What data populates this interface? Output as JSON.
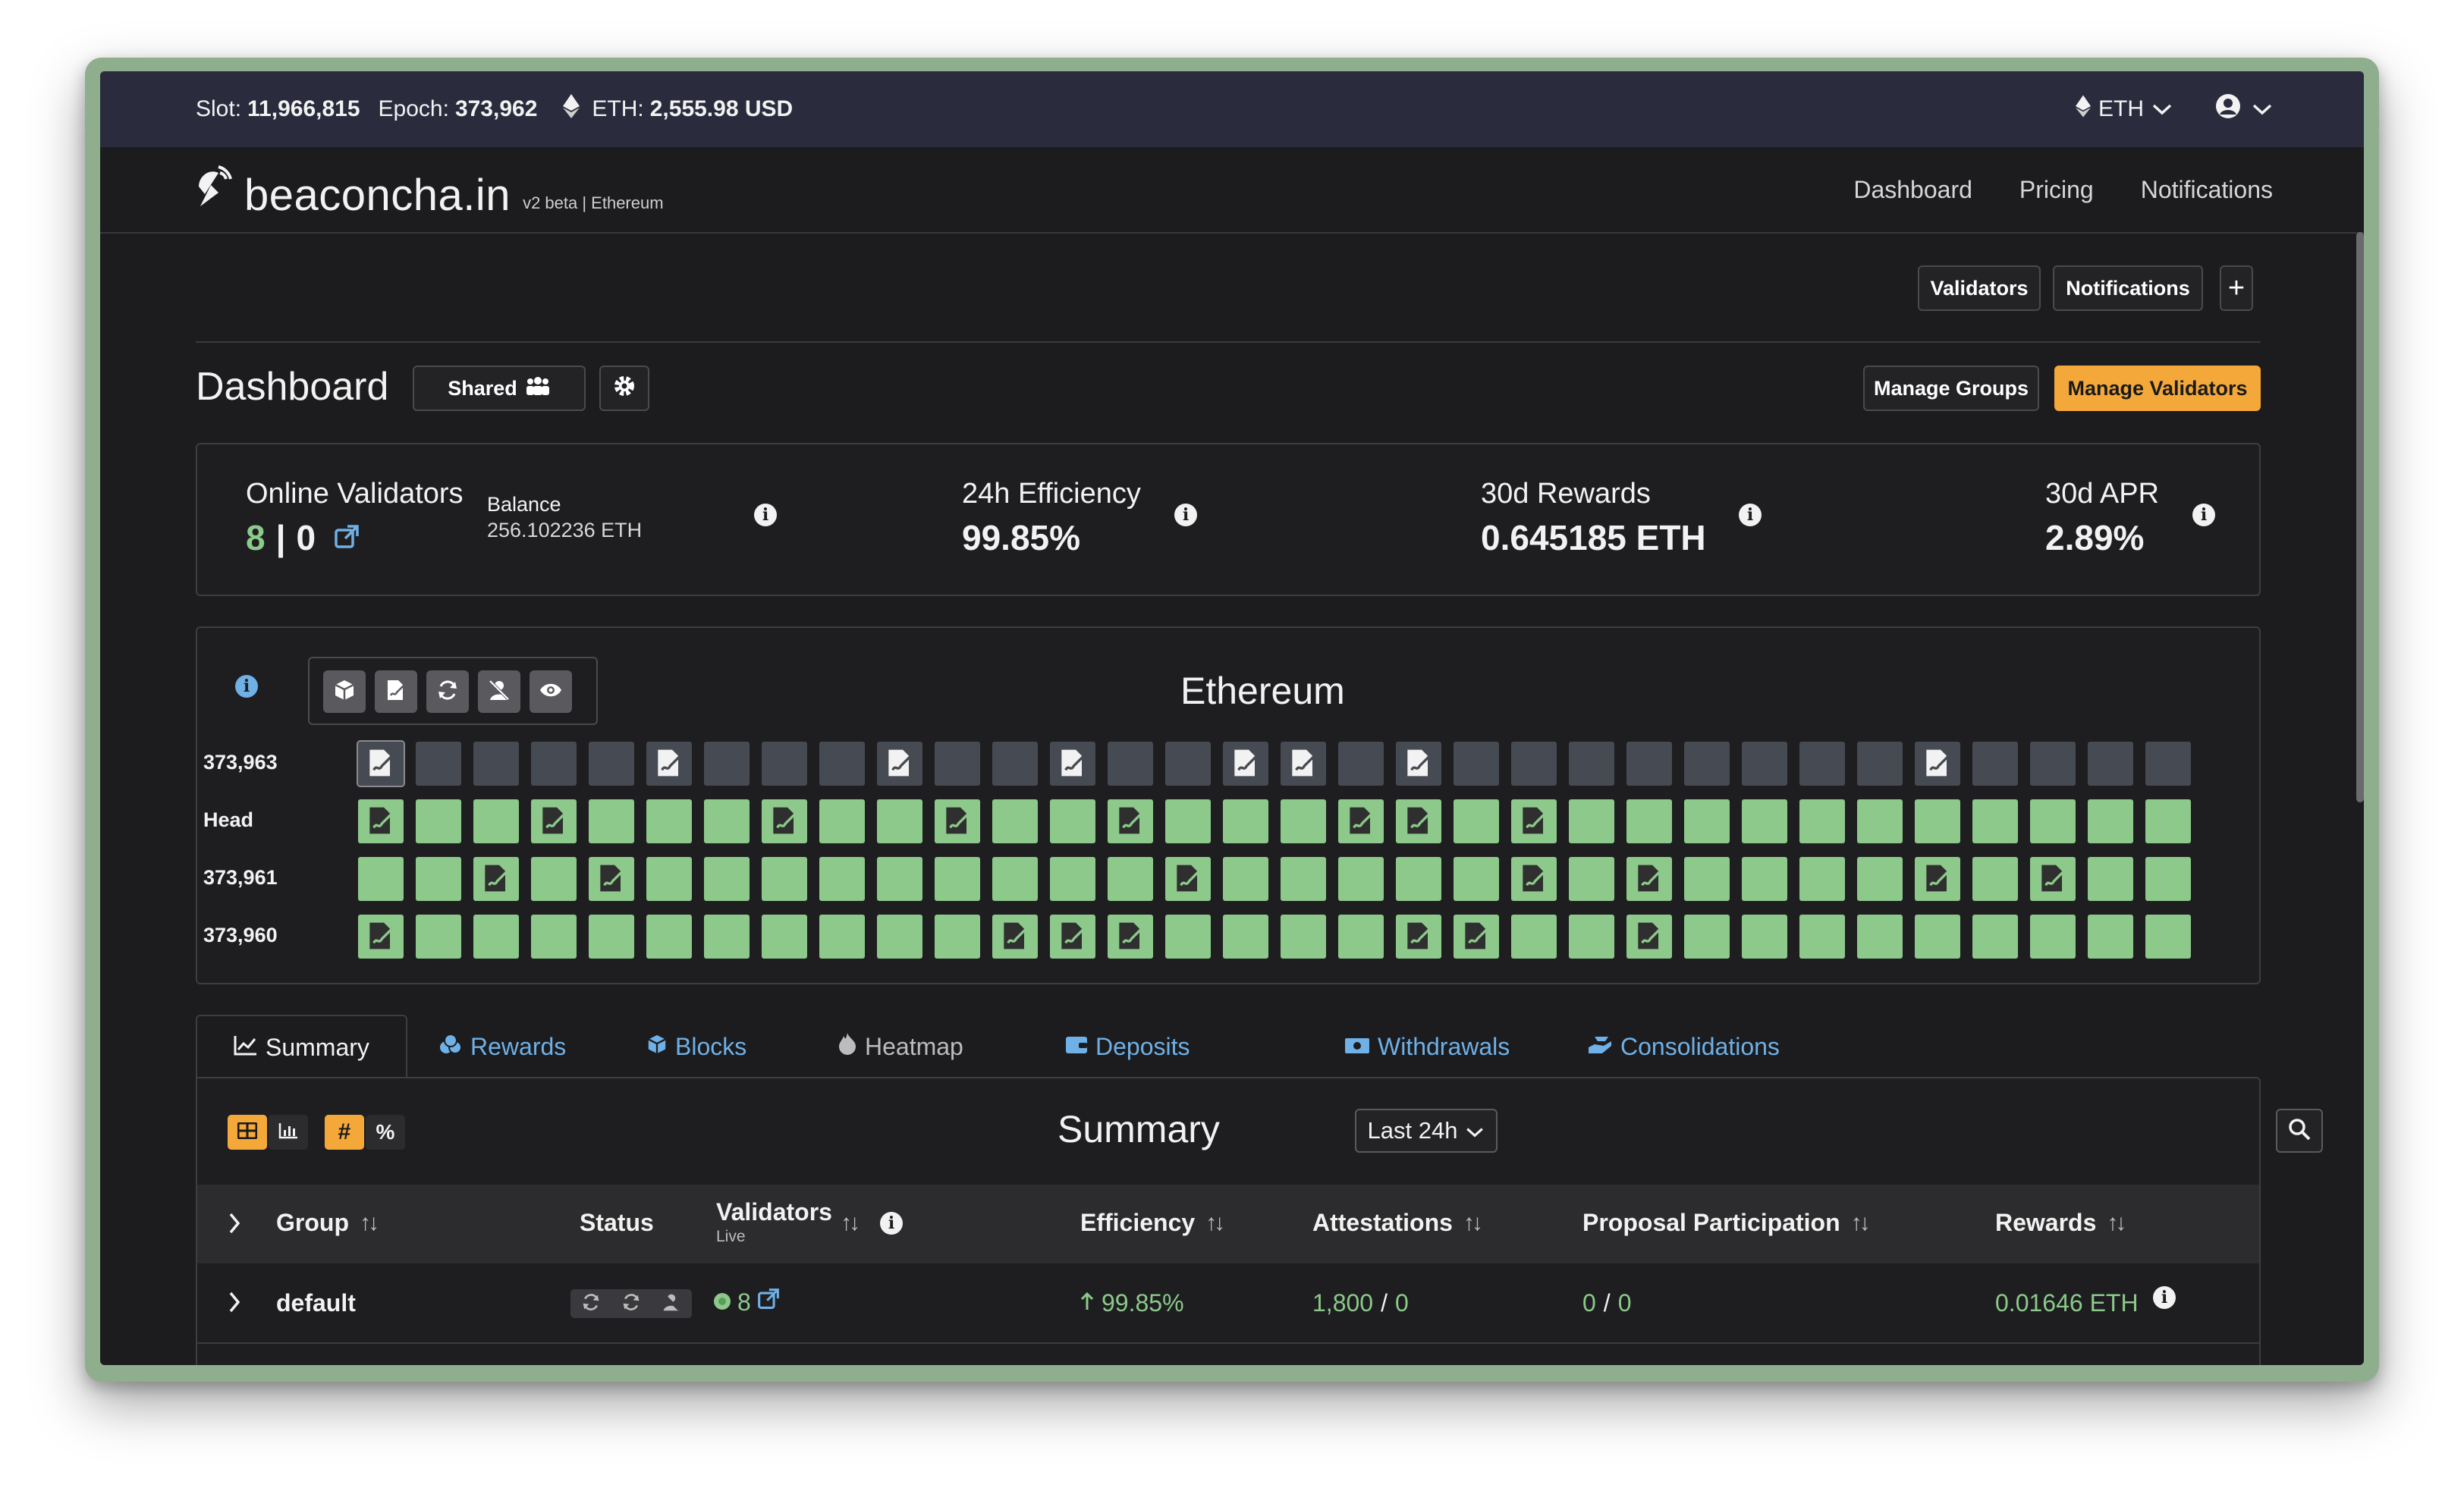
{
  "topbar": {
    "slot_label": "Slot:",
    "slot_value": "11,966,815",
    "epoch_label": "Epoch:",
    "epoch_value": "373,962",
    "eth_label": "ETH:",
    "eth_value": "2,555.98 USD",
    "currency": "ETH"
  },
  "navbar": {
    "brand": "beaconcha.in",
    "brand_sub": "v2 beta | Ethereum",
    "links": [
      "Dashboard",
      "Pricing",
      "Notifications"
    ]
  },
  "toolbar": {
    "validators_btn": "Validators",
    "notifications_btn": "Notifications",
    "add_btn": "+"
  },
  "dashboard": {
    "title": "Dashboard",
    "shared_btn": "Shared",
    "manage_groups_btn": "Manage Groups",
    "manage_validators_btn": "Manage Validators"
  },
  "kpis": {
    "online_title": "Online Validators",
    "online_green": "8",
    "online_sep": "|",
    "online_red": "0",
    "balance_label": "Balance",
    "balance_value": "256.102236 ETH",
    "efficiency_title": "24h Efficiency",
    "efficiency_value": "99.85%",
    "rewards_title": "30d Rewards",
    "rewards_value": "0.645185 ETH",
    "apr_title": "30d APR",
    "apr_value": "2.89%"
  },
  "epochs": {
    "title": "Ethereum",
    "rows": [
      {
        "label": "373,963",
        "cells": "MEEEEMEEEEMEEEMEEEMMEMEEEEEEEEEEMEEEE",
        "fill": "empty-first"
      },
      {
        "label": "Head",
        "cells": "MGGMGGGMGGGMGGMGGGGMMGMGGGGGGGGGGGGG"
      },
      {
        "label": "373,961",
        "cells": "GGMGMGGGGGGGGGGGGGGGGGGGGGGGGGGGGGGG"
      },
      {
        "label": "373,960",
        "cells": "MGGGGGGGGGGGGGGGGGGGGGGGGGGGGGGGGGGG"
      }
    ]
  },
  "tabs": [
    "Summary",
    "Rewards",
    "Blocks",
    "Heatmap",
    "Deposits",
    "Withdrawals",
    "Consolidations"
  ],
  "summary": {
    "title": "Summary",
    "range": "Last 24h",
    "columns": {
      "group": "Group",
      "status": "Status",
      "validators": "Validators",
      "validators_sub": "Live",
      "efficiency": "Efficiency",
      "attestations": "Attestations",
      "proposal": "Proposal Participation",
      "rewards": "Rewards"
    },
    "row": {
      "group": "default",
      "validators": "8",
      "efficiency": "99.85%",
      "attest_ok": "1,800",
      "attest_sep": "/",
      "attest_fail": "0",
      "prop_ok": "0",
      "prop_sep": "/",
      "prop_fail": "0",
      "rewards": "0.01646 ETH"
    }
  },
  "colors": {
    "accent": "#f4a83a",
    "green": "#8cc98a",
    "link": "#6fb0e6",
    "topbar": "#2a2b3d",
    "background": "#1c1c1e"
  }
}
